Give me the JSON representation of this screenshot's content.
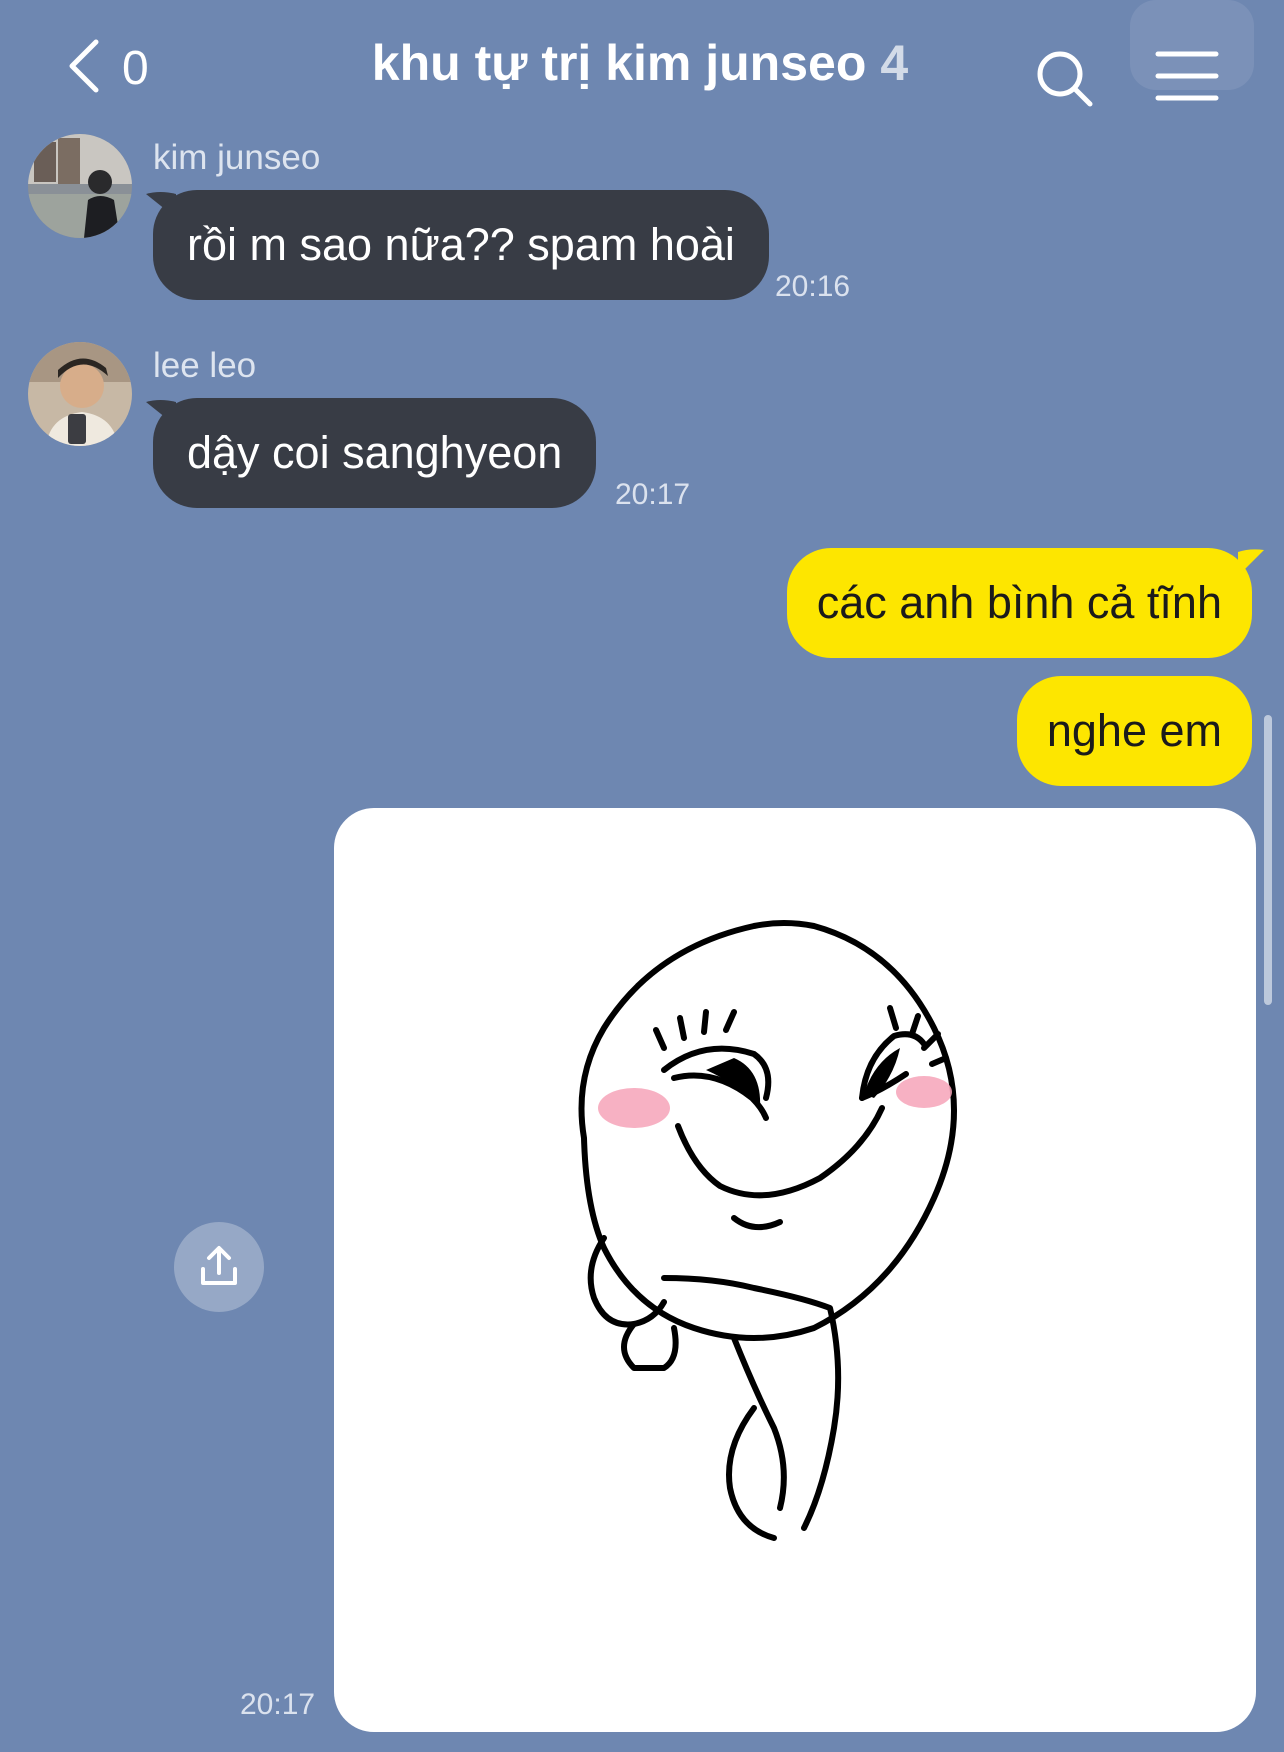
{
  "header": {
    "back_count": "0",
    "title": "khu tự trị kim junseo",
    "member_count": "4"
  },
  "messages": [
    {
      "sender": "kim junseo",
      "text": "rồi m sao nữa?? spam hoài",
      "time": "20:16"
    },
    {
      "sender": "lee leo",
      "text": "dậy coi sanghyeon",
      "time": "20:17"
    },
    {
      "text": "các anh bình cả tĩnh"
    },
    {
      "text": "nghe em"
    },
    {
      "type": "sticker",
      "time": "20:17"
    }
  ],
  "colors": {
    "background": "#6e87b1",
    "incoming_bubble": "#383c45",
    "outgoing_bubble": "#fde600"
  },
  "icons": [
    "chevron-left-icon",
    "search-icon",
    "menu-icon",
    "share-icon"
  ]
}
